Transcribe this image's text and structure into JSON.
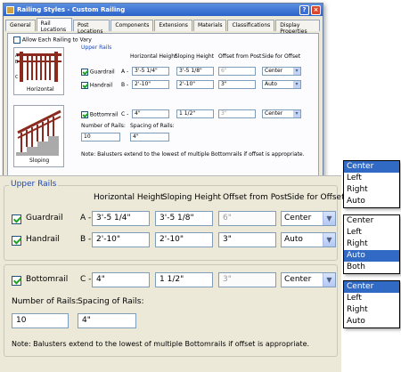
{
  "window": {
    "title": "Railing Styles - Custom Railing"
  },
  "tabs": [
    "General",
    "Rail Locations",
    "Post Locations",
    "Components",
    "Extensions",
    "Materials",
    "Classifications",
    "Display Properties"
  ],
  "allow_vary": "Allow Each Railing to Vary",
  "upper_rails_label": "Upper Rails",
  "headers": {
    "horizontal": "Horizontal Height",
    "sloping": "Sloping Height",
    "offset": "Offset from Post",
    "side": "Side for Offset"
  },
  "rows": [
    {
      "label": "Guardrail",
      "letter": "A -",
      "horizontal": "3'-5 1/4\"",
      "sloping": "3'-5 1/8\"",
      "offset": "6\"",
      "side": "Center",
      "checked": true
    },
    {
      "label": "Handrail",
      "letter": "B -",
      "horizontal": "2'-10\"",
      "sloping": "2'-10\"",
      "offset": "3\"",
      "side": "Auto",
      "checked": true
    }
  ],
  "bottomrail": {
    "label": "Bottomrail",
    "letter": "C -",
    "horizontal": "4\"",
    "sloping": "1 1/2\"",
    "offset": "3\"",
    "side": "Center",
    "checked": true
  },
  "num_rails_label": "Number of Rails:",
  "num_rails": "10",
  "spacing_label": "Spacing of Rails:",
  "spacing": "4\"",
  "note": "Note: Balusters extend to the lowest of multiple Bottomrails if offset is appropriate.",
  "thumbs": {
    "horizontal": "Horizontal",
    "sloping": "Sloping"
  },
  "dropdowns": [
    {
      "options": [
        "Center",
        "Left",
        "Right",
        "Auto"
      ],
      "selected": 0
    },
    {
      "options": [
        "Center",
        "Left",
        "Right",
        "Auto",
        "Both"
      ],
      "selected": 3
    },
    {
      "options": [
        "Center",
        "Left",
        "Right",
        "Auto"
      ],
      "selected": 0
    }
  ]
}
